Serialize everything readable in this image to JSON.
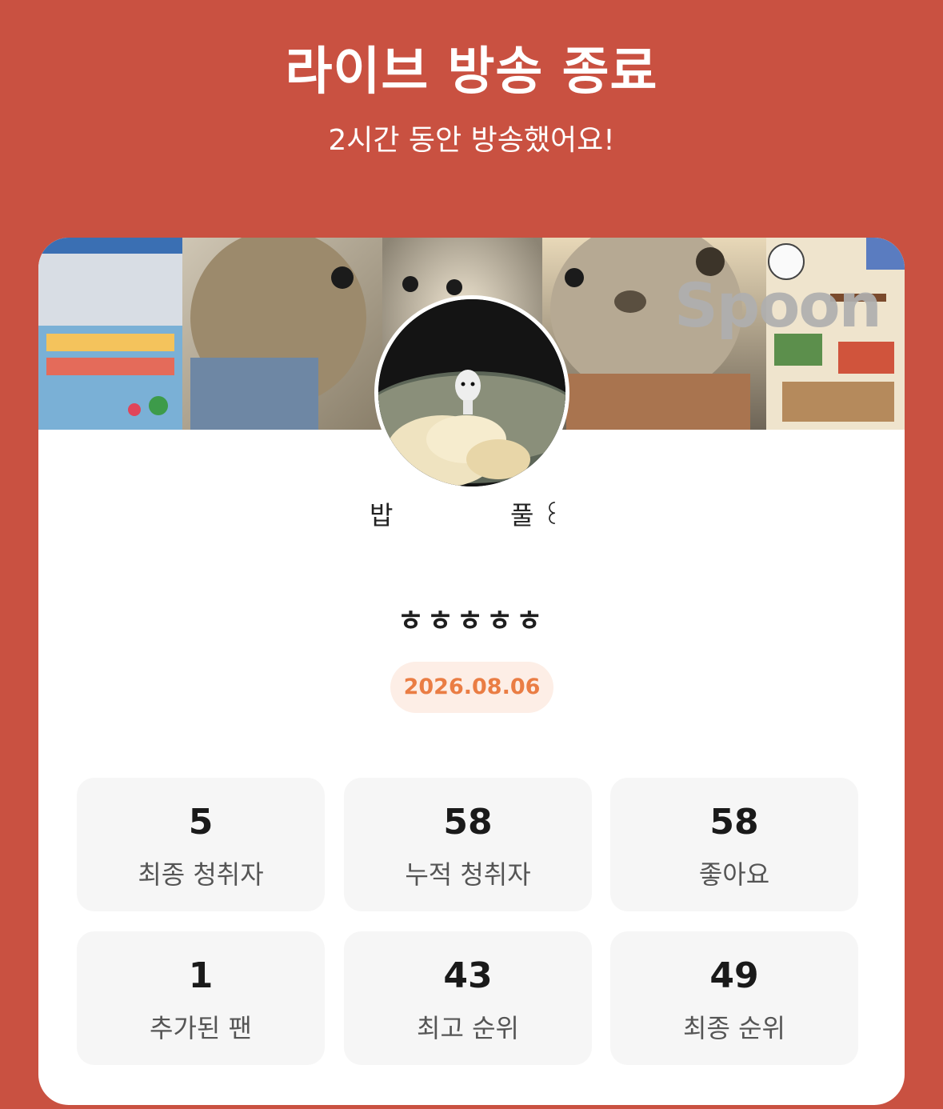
{
  "header": {
    "title": "라이브 방송 종료",
    "subtitle": "2시간 동안 방송했어요!"
  },
  "card": {
    "brand_logo_text": "Spoon",
    "nickname": {
      "part1": "밥",
      "part2": "풀 ꒰"
    },
    "live_title": "ㅎㅎㅎㅎㅎ",
    "date": "2026.08.06",
    "stats": [
      {
        "value": "5",
        "label": "최종 청취자"
      },
      {
        "value": "58",
        "label": "누적 청취자"
      },
      {
        "value": "58",
        "label": "좋아요"
      },
      {
        "value": "1",
        "label": "추가된 팬"
      },
      {
        "value": "43",
        "label": "최고 순위"
      },
      {
        "value": "49",
        "label": "최종 순위"
      }
    ]
  },
  "colors": {
    "background": "#c95141",
    "date_text": "#ea7d44",
    "date_bg": "#fdeee6",
    "stat_bg": "#f6f6f6"
  },
  "icons": [
    "banner-photo",
    "profile-avatar"
  ]
}
